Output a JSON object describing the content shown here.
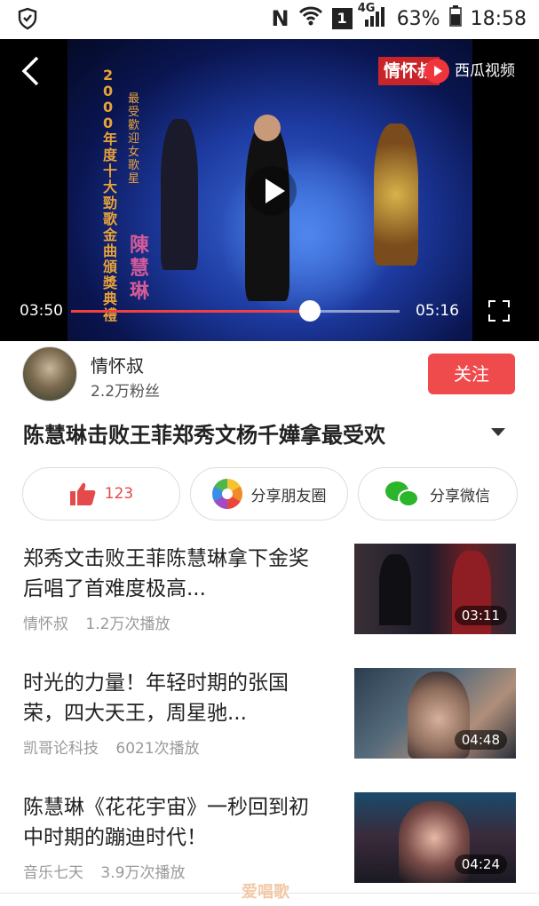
{
  "status_bar": {
    "network_letter": "N",
    "sim": "1",
    "network_type": "4G",
    "battery": "63%",
    "time": "18:58"
  },
  "video": {
    "channel_logo": "情怀叔",
    "platform": "西瓜视频",
    "current_time": "03:50",
    "total_time": "05:16",
    "progress": 0.727,
    "overlay_title": "2000年度十大勁歌金曲頒獎典禮",
    "overlay_subtitle": "最受歡迎女歌星",
    "overlay_name": "陳慧琳"
  },
  "author": {
    "name": "情怀叔",
    "fans": "2.2万粉丝",
    "follow_label": "关注"
  },
  "title": "陈慧琳击败王菲郑秀文杨千嬅拿最受欢",
  "actions": {
    "like_count": "123",
    "moments_label": "分享朋友圈",
    "wechat_label": "分享微信"
  },
  "recommendations": [
    {
      "title": "郑秀文击败王菲陈慧琳拿下金奖后唱了首难度极高...",
      "author": "情怀叔",
      "plays": "1.2万次播放",
      "duration": "03:11"
    },
    {
      "title": "时光的力量！年轻时期的张国荣，四大天王，周星驰...",
      "author": "凯哥论科技",
      "plays": "6021次播放",
      "duration": "04:48"
    },
    {
      "title": "陈慧琳《花花宇宙》一秒回到初中时期的蹦迪时代！",
      "author": "音乐七天",
      "plays": "3.9万次播放",
      "duration": "04:24"
    }
  ],
  "watermark": "爱唱歌",
  "colors": {
    "accent": "#f04b4c",
    "wechat": "#2bb52b"
  },
  "icons": [
    "shield-icon",
    "wifi-icon",
    "signal-icon",
    "battery-icon",
    "back-icon",
    "play-icon",
    "fullscreen-icon",
    "thumb-up-icon",
    "moments-icon",
    "wechat-icon",
    "chevron-down-icon"
  ]
}
